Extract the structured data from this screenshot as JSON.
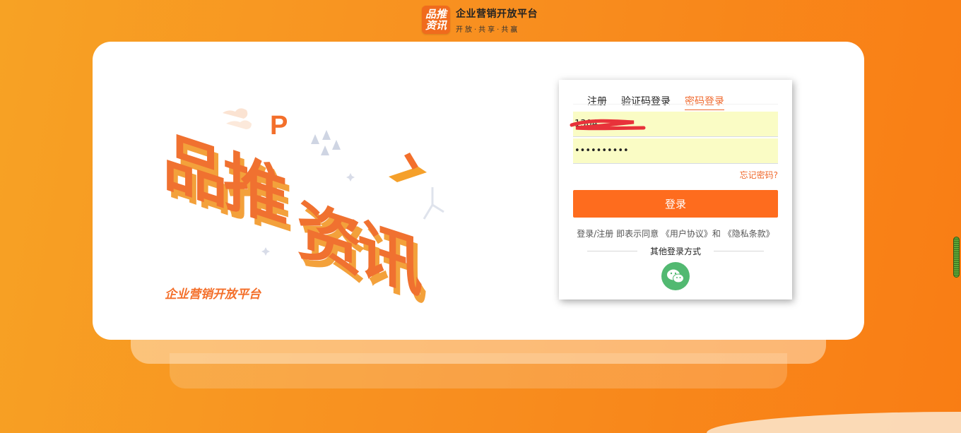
{
  "header": {
    "logo_line1": "品推",
    "logo_line2": "资讯",
    "title": "企业营销开放平台",
    "subtitle": "开放·共享·共赢"
  },
  "hero": {
    "big_text": "品推资讯",
    "slogan": "企业营销开放平台"
  },
  "login": {
    "tabs": [
      "注册",
      "验证码登录",
      "密码登录"
    ],
    "active_tab": "密码登录",
    "phone_value": "1304",
    "password_value": "••••••••••",
    "forgot_label": "忘记密码?",
    "submit_label": "登录",
    "agreement_prefix": "登录/注册 即表示同意",
    "user_agreement": "《用户协议》",
    "and": "和",
    "privacy_policy": "《隐私条款》",
    "other_methods": "其他登录方式"
  },
  "colors": {
    "accent": "#fe6c1e",
    "input_bg": "#fafcc5",
    "wechat": "#52b971"
  }
}
